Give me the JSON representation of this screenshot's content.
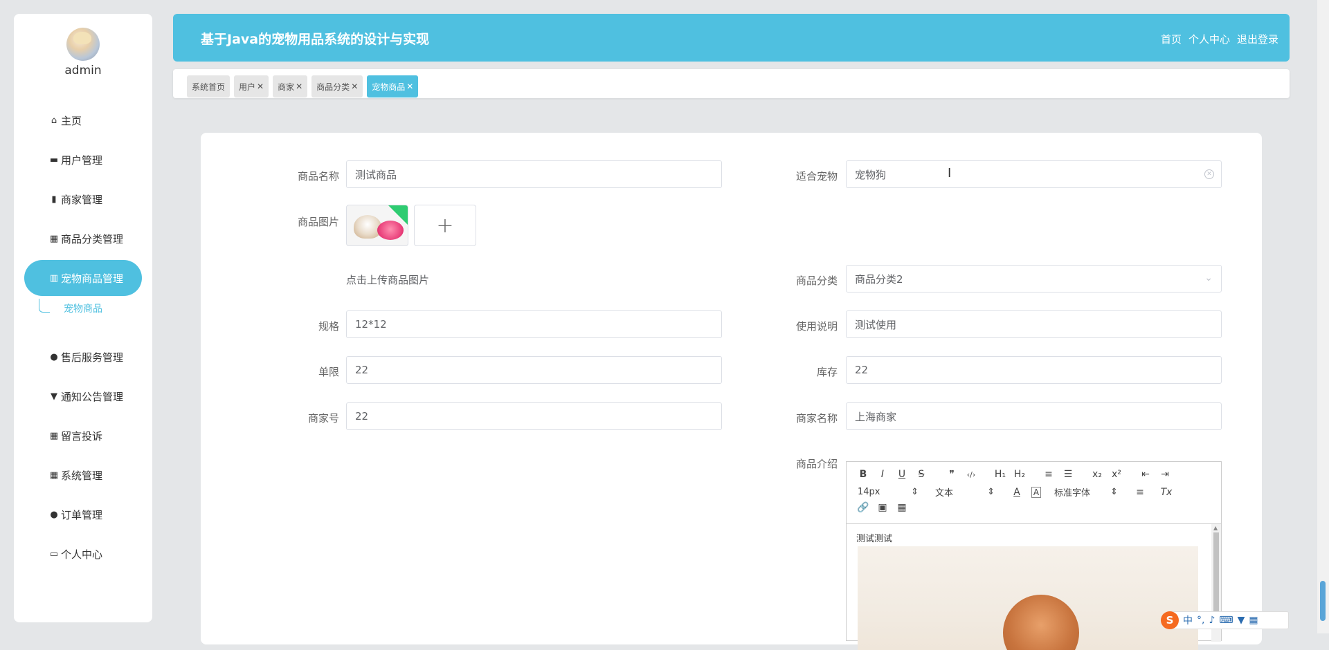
{
  "sidebar": {
    "username": "admin",
    "items": [
      {
        "label": "主页",
        "icon": "home-icon"
      },
      {
        "label": "用户管理",
        "icon": "monitor-icon"
      },
      {
        "label": "商家管理",
        "icon": "clipboard-icon"
      },
      {
        "label": "商品分类管理",
        "icon": "grid-icon"
      },
      {
        "label": "宠物商品管理",
        "icon": "bar-chart-icon"
      },
      {
        "label": "售后服务管理",
        "icon": "user-icon"
      },
      {
        "label": "通知公告管理",
        "icon": "pin-icon"
      },
      {
        "label": "留言投诉",
        "icon": "grid-icon"
      },
      {
        "label": "系统管理",
        "icon": "grid-icon"
      },
      {
        "label": "订单管理",
        "icon": "user-icon"
      },
      {
        "label": "个人中心",
        "icon": "card-icon"
      }
    ],
    "submenu": {
      "label": "宠物商品"
    }
  },
  "header": {
    "title": "基于Java的宠物用品系统的设计与实现",
    "nav": {
      "home": "首页",
      "profile": "个人中心",
      "logout": "退出登录"
    }
  },
  "tabs": [
    {
      "label": "系统首页",
      "closable": false
    },
    {
      "label": "用户",
      "closable": true
    },
    {
      "label": "商家",
      "closable": true
    },
    {
      "label": "商品分类",
      "closable": true
    },
    {
      "label": "宠物商品",
      "closable": true,
      "active": true
    }
  ],
  "form": {
    "name": {
      "label": "商品名称",
      "value": "测试商品"
    },
    "pet": {
      "label": "适合宠物",
      "value": "宠物狗"
    },
    "image": {
      "label": "商品图片",
      "hint": "点击上传商品图片"
    },
    "category": {
      "label": "商品分类",
      "value": "商品分类2"
    },
    "spec": {
      "label": "规格",
      "value": "12*12"
    },
    "usage": {
      "label": "使用说明",
      "value": "测试使用"
    },
    "limit": {
      "label": "单限",
      "value": "22"
    },
    "stock": {
      "label": "库存",
      "value": "22"
    },
    "merchant_no": {
      "label": "商家号",
      "value": "22"
    },
    "merchant_name": {
      "label": "商家名称",
      "value": "上海商家"
    },
    "intro": {
      "label": "商品介绍",
      "content_text": "测试测试"
    }
  },
  "editor": {
    "font_size": "14px",
    "text_type": "文本",
    "font_family": "标准字体",
    "buttons_row1": [
      "B",
      "I",
      "U",
      "S",
      "❞",
      "‹/›",
      "H₁",
      "H₂",
      "≡",
      "☰",
      "x₂",
      "x²",
      "⇤",
      "⇥"
    ],
    "buttons_row2_extra": [
      "A",
      "A",
      "≡",
      "Tx"
    ],
    "buttons_row3": [
      "🔗",
      "▣",
      "▦"
    ]
  },
  "ime": {
    "lang": "中",
    "punct": "°,"
  }
}
